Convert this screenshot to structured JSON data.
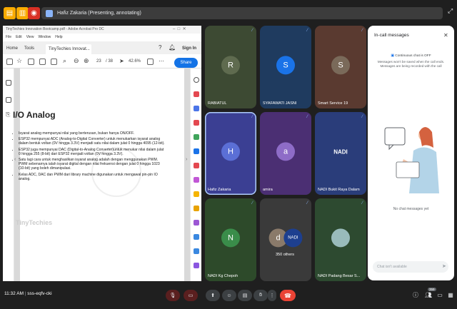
{
  "presenting_chip": "Hafiz Zakaria (Presenting, annotating)",
  "acrobat": {
    "title": "TinyTechies Innovation Bootcamp.pdf - Adobe Acrobat Pro DC",
    "menu": [
      "File",
      "Edit",
      "View",
      "Window",
      "Help"
    ],
    "tabs": [
      "Home",
      "Tools"
    ],
    "doc_tab": "TinyTechies Innovat...",
    "sign_in": "Sign In",
    "page_current": "23",
    "page_total": "/ 38",
    "zoom": "42.6%",
    "share": "Share"
  },
  "slide": {
    "title": "I/O Analog",
    "bullets": [
      "Isyarat analog mempunyai nilai yang berterusan, bukan hanya ON/OFF.",
      "ESP32 mempunyai ADC (Analog-to-Digital Converter) untuk menukarkan isyarat analog dalam bentuk voltan (0V hingga 3.3V) menjadi satu nilai dalam julat 0 hingga 4095 (12-bit).",
      "ESP32 juga mempunyai DAC (Digital-to-Analog Converter)untuk menukar nilai dalam julat 0 hingga 255 (8-bit) dari ESP32 menjadi voltan (0V hingga 3.3V).",
      "Satu lagi cara untuk menghasilkan isyarat analog adalah dengan menggunakan PWM. PWM sebenarnya ialah isyarat digital dengan nilai frekuensi dengan julat 0 hingga 1023 (10-bit) yang boleh diman­ipulasi.",
      "Kelas ADC, DAC dan PWM dari library machine digunakan untuk mengawal pin-pin IO analog."
    ],
    "logo": "TinyTechies"
  },
  "tiles": [
    {
      "name": "RABIATUL",
      "initial": "R",
      "color": "#5f6b4f",
      "bg": "#3d4a33"
    },
    {
      "name": "SYAFAWATI JASNI",
      "initial": "S",
      "color": "#1a73e8",
      "bg": "#1f3b5f"
    },
    {
      "name": "Smart Service 19",
      "initial": "S",
      "color": "#7a6a5a",
      "bg": "#5a3a30"
    },
    {
      "name": "Hafiz Zakaria",
      "initial": "H",
      "color": "#5b6fd6",
      "bg": "#3b3f93"
    },
    {
      "name": "amira",
      "initial": "a",
      "color": "#8e6cc7",
      "bg": "#4b2f73"
    },
    {
      "name": "NADI Bukit Raya Dalam",
      "initial": "NADI",
      "color": "#1d3f8f",
      "bg": "#2a3d7a"
    },
    {
      "name": "NADI Kg Chepoh",
      "initial": "N",
      "color": "#3a8d4a",
      "bg": "#2d4a2a"
    },
    {
      "name": "350 others",
      "initial": "d",
      "color": "#8a7a6a",
      "bg": "#3a3a3a"
    },
    {
      "name": "NADI Padang Besar S...",
      "initial": "",
      "color": "#567",
      "bg": "#2d4a30"
    }
  ],
  "chat": {
    "title": "In-call messages",
    "toggle": "Continuous chat is OFF",
    "note": "Messages won't be saved when the call ends. Messages are being recorded with the call",
    "empty": "No chat messages yet",
    "placeholder": "Chat isn't available"
  },
  "bottom": {
    "time": "11:32 AM",
    "code": "sss-eqfv-cki",
    "participants_badge": "359"
  }
}
